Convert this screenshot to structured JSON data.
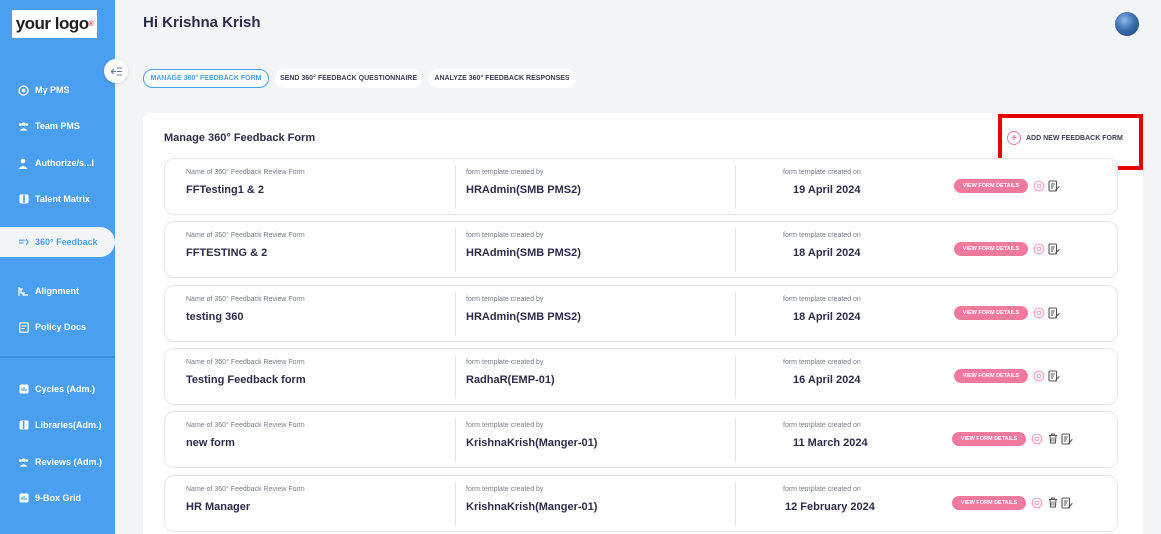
{
  "brand": {
    "logo_text": "your logo",
    "logo_mark": "®"
  },
  "sidebar": {
    "collapse_icon": "collapse-menu-icon",
    "items": [
      {
        "label": "My PMS",
        "icon": "target-icon"
      },
      {
        "label": "Team PMS",
        "icon": "team-icon"
      },
      {
        "label": "Authorize/s...l",
        "icon": "user-check-icon"
      },
      {
        "label": "Talent Matrix",
        "icon": "matrix-icon"
      },
      {
        "label": "360° Feedback",
        "icon": "feedback-icon",
        "active": true
      },
      {
        "label": "Alignment",
        "icon": "alignment-icon"
      },
      {
        "label": "Policy Docs",
        "icon": "document-icon"
      },
      {
        "label": "Cycles (Adm.)",
        "icon": "cycles-icon"
      },
      {
        "label": "Libraries(Adm.)",
        "icon": "library-icon"
      },
      {
        "label": "Reviews (Adm.)",
        "icon": "reviews-icon"
      },
      {
        "label": "9-Box Grid",
        "icon": "grid-icon"
      }
    ]
  },
  "header": {
    "greeting": "Hi Krishna Krish"
  },
  "tabs": [
    {
      "label": "MANAGE 360° FEEDBACK FORM",
      "active": true
    },
    {
      "label": "SEND 360° FEEDBACK QUESTIONNAIRE",
      "active": false
    },
    {
      "label": "ANALYZE 360° FEEDBACK RESPONSES",
      "active": false
    }
  ],
  "panel": {
    "title": "Manage 360° Feedback Form",
    "add_button": "ADD NEW FEEDBACK FORM",
    "col_labels": {
      "name": "Name of 360° Feedback Review Form",
      "creator": "form template created by",
      "date": "form template created on"
    },
    "view_button": "VIEW FORM DETAILS",
    "rows": [
      {
        "name": "FFTesting1 & 2",
        "creator": "HRAdmin(SMB PMS2)",
        "date": "19 April 2024",
        "deletable": false
      },
      {
        "name": "FFTESTING & 2",
        "creator": "HRAdmin(SMB PMS2)",
        "date": "18 April 2024",
        "deletable": false
      },
      {
        "name": "testing 360",
        "creator": "HRAdmin(SMB PMS2)",
        "date": "18 April 2024",
        "deletable": false
      },
      {
        "name": "Testing Feedback form",
        "creator": "RadhaR(EMP-01)",
        "date": "16 April 2024",
        "deletable": false
      },
      {
        "name": "new form",
        "creator": "KrishnaKrish(Manger-01)",
        "date": "11 March 2024",
        "deletable": true
      },
      {
        "name": "HR Manager",
        "creator": "KrishnaKrish(Manger-01)",
        "date": "12 February 2024",
        "deletable": true
      }
    ]
  },
  "colors": {
    "sidebar": "#4a9ff0",
    "accent_pink": "#f0799e",
    "highlight": "#e60000"
  }
}
